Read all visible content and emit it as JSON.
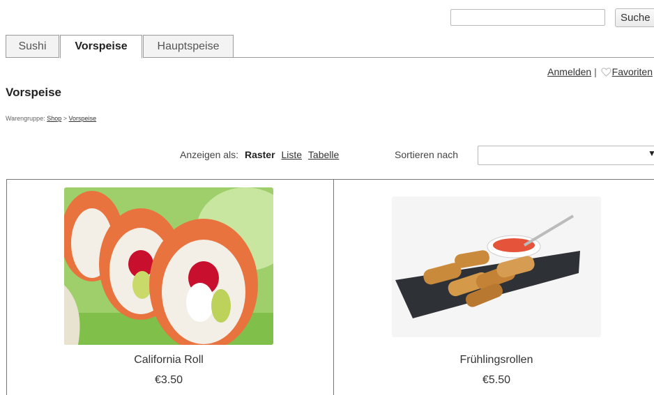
{
  "search": {
    "placeholder": "",
    "value": "",
    "button_label": "Suche"
  },
  "tabs": [
    {
      "label": "Sushi",
      "active": false
    },
    {
      "label": "Vorspeise",
      "active": true
    },
    {
      "label": "Hauptspeise",
      "active": false
    }
  ],
  "user_links": {
    "login": "Anmelden",
    "separator": "|",
    "favorites": "Favoriten"
  },
  "page_title": "Vorspeise",
  "breadcrumb": {
    "prefix": "Warengruppe:",
    "items": [
      "Shop",
      "Vorspeise"
    ],
    "separator": ">"
  },
  "view": {
    "label": "Anzeigen als:",
    "options": [
      "Raster",
      "Liste",
      "Tabelle"
    ],
    "active": "Raster"
  },
  "sort": {
    "label": "Sortieren nach",
    "value": ""
  },
  "products": [
    {
      "name": "California Roll",
      "price": "€3.50",
      "image_icon": "sushi-roll-image"
    },
    {
      "name": "Frühlingsrollen",
      "price": "€5.50",
      "image_icon": "spring-rolls-image"
    }
  ],
  "colors": {
    "salmon": "#e8733f",
    "rice": "#f4efe6",
    "plate": "#2e3136",
    "border": "#777777"
  }
}
